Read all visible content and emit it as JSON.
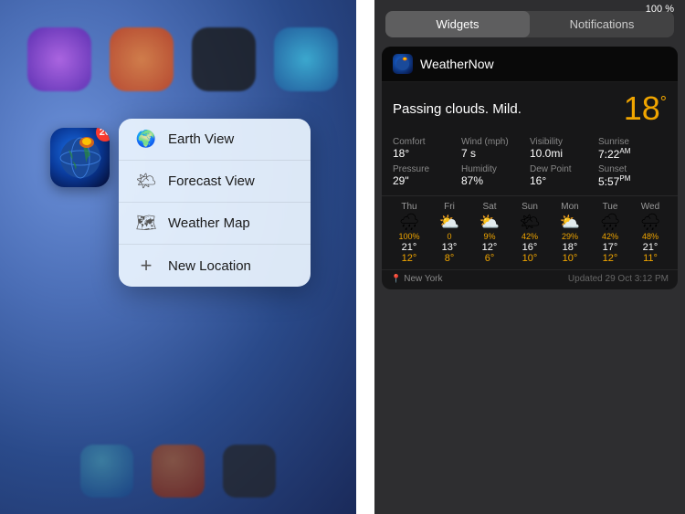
{
  "statusBar": {
    "battery": "100 %"
  },
  "contextMenu": {
    "items": [
      {
        "id": "earth-view",
        "label": "Earth View",
        "icon": "🌍"
      },
      {
        "id": "forecast-view",
        "label": "Forecast View",
        "icon": "🌤"
      },
      {
        "id": "weather-map",
        "label": "Weather Map",
        "icon": "🗺"
      },
      {
        "id": "new-location",
        "label": "New Location",
        "icon": "+"
      }
    ]
  },
  "appIcon": {
    "badge": "20"
  },
  "notificationCenter": {
    "tabs": [
      "Widgets",
      "Notifications"
    ],
    "activeTab": "Widgets"
  },
  "weatherWidget": {
    "appName": "WeatherNow",
    "description": "Passing clouds. Mild.",
    "tempBig": "18",
    "details": [
      {
        "label": "Comfort",
        "value": "18°"
      },
      {
        "label": "Wind (mph)",
        "value": "7 s"
      },
      {
        "label": "Visibility",
        "value": "10.0mi"
      },
      {
        "label": "Sunrise",
        "value": "7:22ᴬᴹ"
      },
      {
        "label": "Pressure",
        "value": "29\""
      },
      {
        "label": "Humidity",
        "value": "87%"
      },
      {
        "label": "Dew Point",
        "value": "16°"
      },
      {
        "label": "Sunset",
        "value": "5:57ᴾᴹ"
      }
    ],
    "forecast": [
      {
        "day": "Thu",
        "icon": "🌧",
        "pct": "100%",
        "high": "21°",
        "low": "12°"
      },
      {
        "day": "Fri",
        "icon": "⛅",
        "pct": "0",
        "high": "13°",
        "low": "8°"
      },
      {
        "day": "Sat",
        "icon": "⛅",
        "pct": "9%",
        "high": "12°",
        "low": "6°"
      },
      {
        "day": "Sun",
        "icon": "🌤",
        "pct": "42%",
        "high": "16°",
        "low": "10°"
      },
      {
        "day": "Mon",
        "icon": "⛅",
        "pct": "29%",
        "high": "18°",
        "low": "10°"
      },
      {
        "day": "Tue",
        "icon": "🌧",
        "pct": "42%",
        "high": "17°",
        "low": "12°"
      },
      {
        "day": "Wed",
        "icon": "🌧",
        "pct": "48%",
        "high": "21°",
        "low": "11°"
      }
    ],
    "location": "New York",
    "updated": "Updated 29 Oct 3:12 PM"
  }
}
